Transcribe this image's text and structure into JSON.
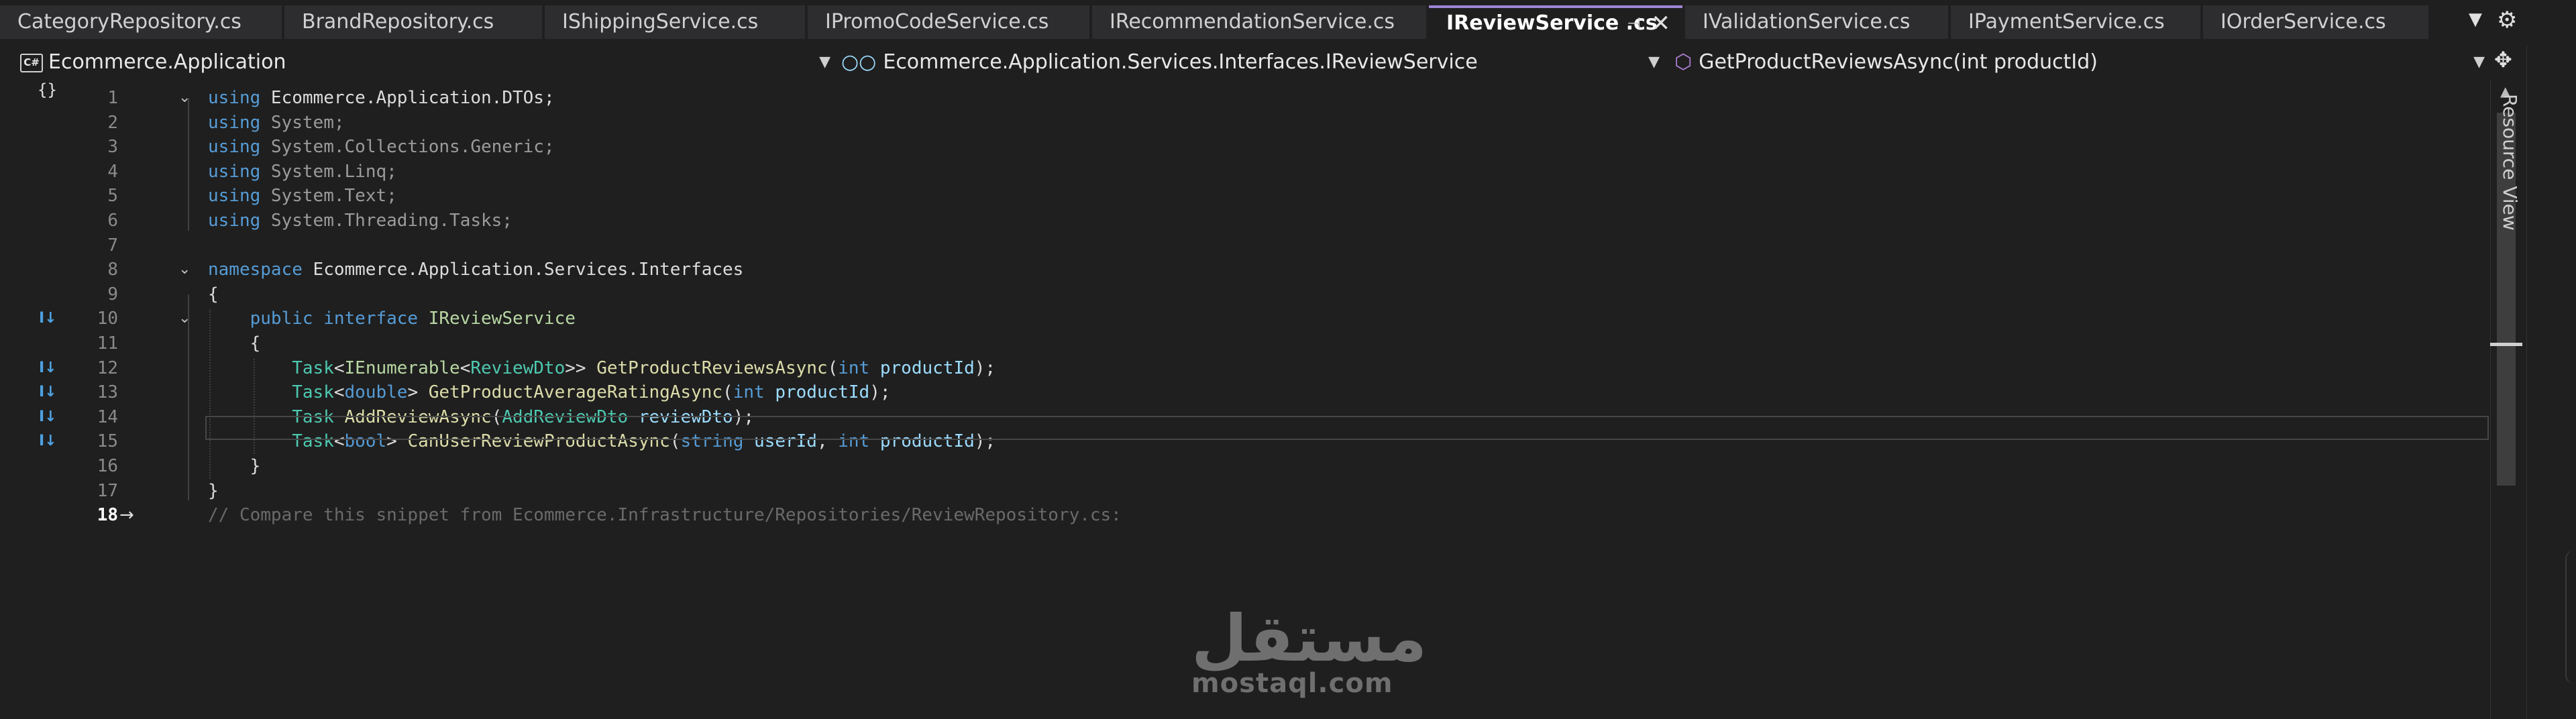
{
  "tabs": [
    {
      "label": "CategoryRepository.cs",
      "active": false
    },
    {
      "label": "BrandRepository.cs",
      "active": false
    },
    {
      "label": "IShippingService.cs",
      "active": false
    },
    {
      "label": "IPromoCodeService.cs",
      "active": false
    },
    {
      "label": "IRecommendationService.cs",
      "active": false
    },
    {
      "label": "IReviewService .cs",
      "active": true
    },
    {
      "label": "IValidationService.cs",
      "active": false
    },
    {
      "label": "IPaymentService.cs",
      "active": false
    },
    {
      "label": "IOrderService.cs",
      "active": false
    }
  ],
  "navbar": {
    "project": "Ecommerce.Application",
    "type": "Ecommerce.Application.Services.Interfaces.IReviewService",
    "member": "GetProductReviewsAsync(int productId)",
    "project_badge": "C#"
  },
  "side_panel": {
    "label": "Resource View"
  },
  "editor": {
    "current_line": 18,
    "lines": [
      {
        "num": "1",
        "tokens": [
          {
            "t": "using",
            "c": "kw"
          },
          {
            "t": " Ecommerce",
            "c": "ns"
          },
          {
            "t": ".",
            "c": "ns"
          },
          {
            "t": "Application",
            "c": "ns"
          },
          {
            "t": ".",
            "c": "ns"
          },
          {
            "t": "DTOs",
            "c": "ns"
          },
          {
            "t": ";",
            "c": "ns"
          }
        ]
      },
      {
        "num": "2",
        "tokens": [
          {
            "t": "using",
            "c": "kw"
          },
          {
            "t": " System;",
            "c": "dim"
          }
        ]
      },
      {
        "num": "3",
        "tokens": [
          {
            "t": "using",
            "c": "kw"
          },
          {
            "t": " System.Collections.Generic;",
            "c": "dim"
          }
        ]
      },
      {
        "num": "4",
        "tokens": [
          {
            "t": "using",
            "c": "kw"
          },
          {
            "t": " System.Linq;",
            "c": "dim"
          }
        ]
      },
      {
        "num": "5",
        "tokens": [
          {
            "t": "using",
            "c": "kw"
          },
          {
            "t": " System.Text;",
            "c": "dim"
          }
        ]
      },
      {
        "num": "6",
        "tokens": [
          {
            "t": "using",
            "c": "kw"
          },
          {
            "t": " System.Threading.Tasks;",
            "c": "dim"
          }
        ]
      },
      {
        "num": "7",
        "tokens": []
      },
      {
        "num": "8",
        "tokens": [
          {
            "t": "namespace",
            "c": "kw"
          },
          {
            "t": " Ecommerce.Application.Services.Interfaces",
            "c": "ns"
          }
        ]
      },
      {
        "num": "9",
        "tokens": [
          {
            "t": "{",
            "c": "ns"
          }
        ]
      },
      {
        "num": "10",
        "tokens": [
          {
            "t": "    ",
            "c": "ns"
          },
          {
            "t": "public",
            "c": "kw"
          },
          {
            "t": " ",
            "c": "ns"
          },
          {
            "t": "interface",
            "c": "kw"
          },
          {
            "t": " ",
            "c": "ns"
          },
          {
            "t": "IReviewService",
            "c": "it"
          }
        ]
      },
      {
        "num": "11",
        "tokens": [
          {
            "t": "    {",
            "c": "ns"
          }
        ]
      },
      {
        "num": "12",
        "tokens": [
          {
            "t": "        ",
            "c": "ns"
          },
          {
            "t": "Task",
            "c": "ty"
          },
          {
            "t": "<",
            "c": "ns"
          },
          {
            "t": "IEnumerable",
            "c": "it"
          },
          {
            "t": "<",
            "c": "ns"
          },
          {
            "t": "ReviewDto",
            "c": "ty"
          },
          {
            "t": ">> ",
            "c": "ns"
          },
          {
            "t": "GetProductReviewsAsync",
            "c": "fn"
          },
          {
            "t": "(",
            "c": "ns"
          },
          {
            "t": "int",
            "c": "kw"
          },
          {
            "t": " ",
            "c": "ns"
          },
          {
            "t": "productId",
            "c": "pa"
          },
          {
            "t": ");",
            "c": "ns"
          }
        ]
      },
      {
        "num": "13",
        "tokens": [
          {
            "t": "        ",
            "c": "ns"
          },
          {
            "t": "Task",
            "c": "ty"
          },
          {
            "t": "<",
            "c": "ns"
          },
          {
            "t": "double",
            "c": "kw"
          },
          {
            "t": "> ",
            "c": "ns"
          },
          {
            "t": "GetProductAverageRatingAsync",
            "c": "fn"
          },
          {
            "t": "(",
            "c": "ns"
          },
          {
            "t": "int",
            "c": "kw"
          },
          {
            "t": " ",
            "c": "ns"
          },
          {
            "t": "productId",
            "c": "pa"
          },
          {
            "t": ");",
            "c": "ns"
          }
        ]
      },
      {
        "num": "14",
        "tokens": [
          {
            "t": "        ",
            "c": "ns"
          },
          {
            "t": "Task",
            "c": "ty"
          },
          {
            "t": " ",
            "c": "ns"
          },
          {
            "t": "AddReviewAsync",
            "c": "fn"
          },
          {
            "t": "(",
            "c": "ns"
          },
          {
            "t": "AddReviewDto",
            "c": "ty"
          },
          {
            "t": " ",
            "c": "ns"
          },
          {
            "t": "reviewDto",
            "c": "pa"
          },
          {
            "t": ");",
            "c": "ns"
          }
        ]
      },
      {
        "num": "15",
        "tokens": [
          {
            "t": "        ",
            "c": "ns"
          },
          {
            "t": "Task",
            "c": "ty"
          },
          {
            "t": "<",
            "c": "ns"
          },
          {
            "t": "bool",
            "c": "kw"
          },
          {
            "t": "> ",
            "c": "ns"
          },
          {
            "t": "CanUserReviewProductAsync",
            "c": "fn"
          },
          {
            "t": "(",
            "c": "ns"
          },
          {
            "t": "string",
            "c": "kw"
          },
          {
            "t": " ",
            "c": "ns"
          },
          {
            "t": "userId",
            "c": "pa"
          },
          {
            "t": ", ",
            "c": "ns"
          },
          {
            "t": "int",
            "c": "kw"
          },
          {
            "t": " ",
            "c": "ns"
          },
          {
            "t": "productId",
            "c": "pa"
          },
          {
            "t": ");",
            "c": "ns"
          }
        ]
      },
      {
        "num": "16",
        "tokens": [
          {
            "t": "    }",
            "c": "ns"
          }
        ]
      },
      {
        "num": "17",
        "tokens": [
          {
            "t": "}",
            "c": "ns"
          }
        ]
      },
      {
        "num": "18",
        "tokens": [
          {
            "t": "// Compare this snippet from Ecommerce.Infrastructure/Repositories/ReviewRepository.cs:",
            "c": "cm"
          }
        ]
      }
    ]
  },
  "watermark": {
    "arabic": "مستقل",
    "latin": "mostaql.com"
  },
  "colors": {
    "accent": "#9d86d6",
    "background": "#1f1f1f",
    "keyword": "#569cd6",
    "type": "#4ec9b0",
    "method": "#dcdcaa",
    "parameter": "#9cdcfe"
  }
}
